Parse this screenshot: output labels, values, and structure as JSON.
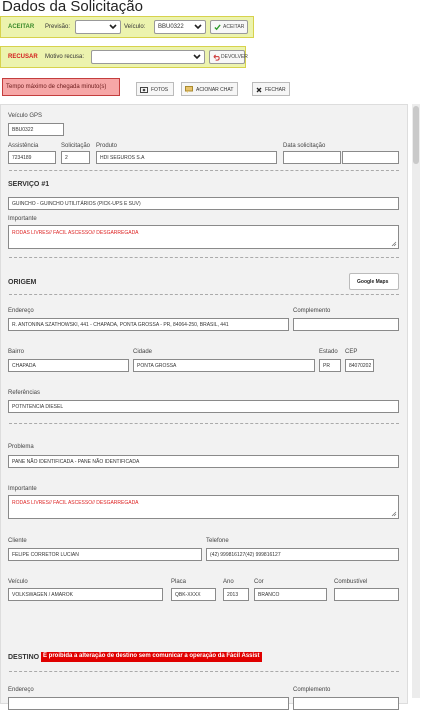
{
  "page": {
    "title": "Dados da Solicitação"
  },
  "accept_bar": {
    "label": "ACEITAR",
    "forecast_label": "Previsão:",
    "forecast_value": "",
    "vehicle_label": "Veículo:",
    "vehicle_value": "BBU0322",
    "button_label": "ACEITAR",
    "label_color": "#3a8a2a"
  },
  "refuse_bar": {
    "label": "RECUSAR",
    "reason_label": "Motivo recusa:",
    "reason_value": "",
    "button_label": "DEVOLVER",
    "label_color": "#d21d1d"
  },
  "alert": {
    "text": "Tempo máximo de chegada minuto(s)",
    "bg": "#f6a7a7"
  },
  "toolbar": {
    "fotos": "FOTOS",
    "chat": "ACIONAR CHAT",
    "fechar": "FECHAR"
  },
  "vehicle_gps": {
    "label": "Veículo GPS",
    "value": "BBU0322"
  },
  "request": {
    "assistencia_label": "Assistência",
    "assistencia_value": "7234189",
    "solicitacao_label": "Solicitação",
    "solicitacao_value": "2",
    "produto_label": "Produto",
    "produto_value": "HDI SEGUROS S.A",
    "data_label": "Data solicitação",
    "data_value": ""
  },
  "service": {
    "heading": "SERVIÇO #1",
    "service_value": "GUINCHO - GUINCHO UTILITÁRIOS (PICK-UPS E SUV)",
    "important_label": "Importante",
    "important_value": "RODAS LIVRES// FACIL ASCESSO// DESGARREGADA"
  },
  "origin": {
    "heading": "ORIGEM",
    "maps_button": "Google Maps",
    "endereco_label": "Endereço",
    "endereco_value": "R. ANTONINA SZATHOWSKI, 441 - CHAPADA, PONTA GROSSA - PR, 84064-250, BRASIL, 441",
    "complemento_label": "Complemento",
    "complemento_value": "",
    "bairro_label": "Bairro",
    "bairro_value": "CHAPADA",
    "cidade_label": "Cidade",
    "cidade_value": "PONTA GROSSA",
    "estado_label": "Estado",
    "estado_value": "PR",
    "cep_label": "CEP",
    "cep_value": "84070202",
    "referencias_label": "Referências",
    "referencias_value": "POTNTENCIA DIESEL"
  },
  "problem": {
    "label": "Problema",
    "value": "PANE NÃO IDENTIFICADA - PANE NÃO IDENTIFICADA",
    "important_label": "Importante",
    "important_value": "RODAS LIVRES// FACIL ASCESSO// DESGARREGADA"
  },
  "client": {
    "cliente_label": "Cliente",
    "cliente_value": "FELIPE CORRETOR LUCIAN",
    "telefone_label": "Telefone",
    "telefone_value": "(42) 999816127(42) 999816127",
    "veiculo_label": "Veículo",
    "veiculo_value": "VOLKSWAGEN / AMAROK",
    "placa_label": "Placa",
    "placa_value": "QBK-XXXX",
    "ano_label": "Ano",
    "ano_value": "2013",
    "cor_label": "Cor",
    "cor_value": "BRANCO",
    "combustivel_label": "Combustível",
    "combustivel_value": ""
  },
  "destination": {
    "heading": "DESTINO",
    "warning": "É proibida a alteração de destino sem comunicar a operação da Fácil Assist",
    "warning_bg": "#e00000",
    "endereco_label": "Endereço",
    "complemento_label": "Complemento"
  },
  "icons": {
    "dropdown": "chevron-down-icon",
    "check": "check-icon",
    "undo": "undo-icon",
    "camera": "camera-icon",
    "chat": "chat-icon",
    "close": "close-icon"
  }
}
